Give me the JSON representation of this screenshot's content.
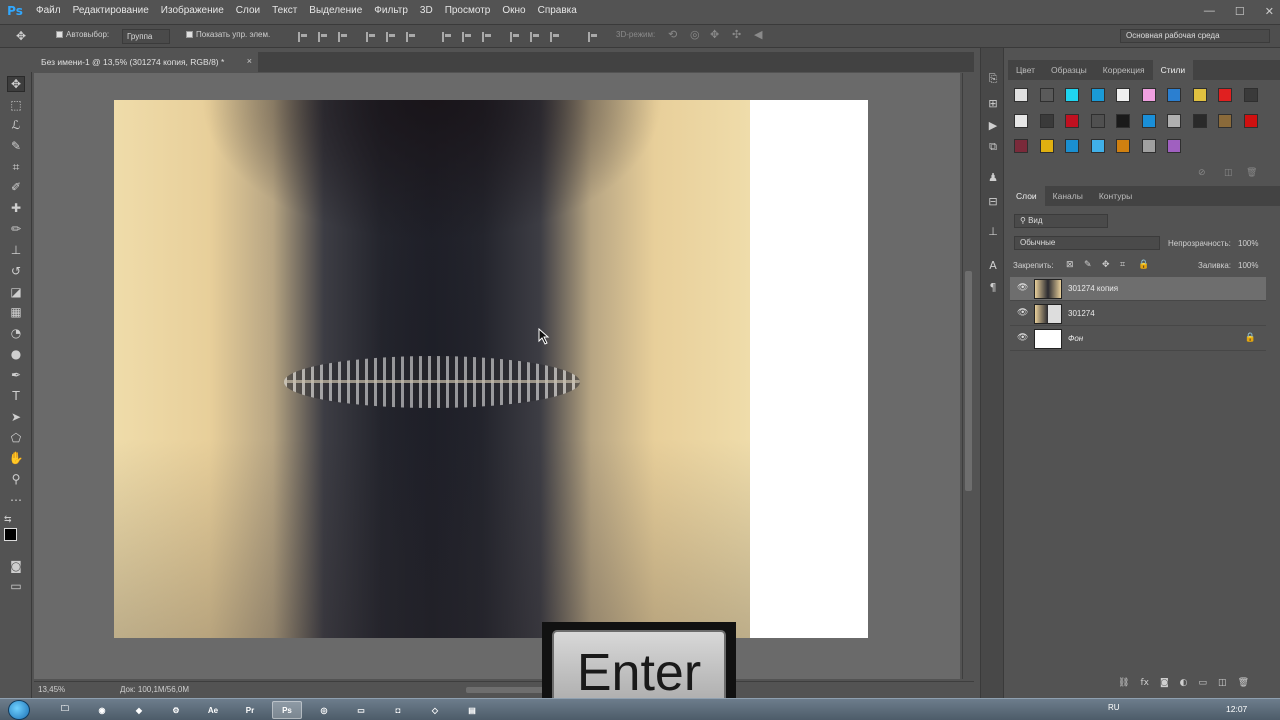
{
  "app": {
    "logo": "Ps"
  },
  "menu": [
    "Файл",
    "Редактирование",
    "Изображение",
    "Слои",
    "Текст",
    "Выделение",
    "Фильтр",
    "3D",
    "Просмотр",
    "Окно",
    "Справка"
  ],
  "window_controls": [
    "—",
    "☐",
    "✕"
  ],
  "options": {
    "autoselect_label": "Автовыбор:",
    "autoselect_value": "Группа",
    "show_transform_label": "Показать упр. элем.",
    "mode_3d_label": "3D-режим:",
    "workspace": "Основная рабочая среда"
  },
  "document": {
    "tab_title": "Без имени-1 @ 13,5% (301274 копия, RGB/8) *",
    "close_glyph": "×",
    "zoom": "13,45%",
    "doc_info": "Док: 100,1M/56,0M"
  },
  "styles_panel": {
    "tabs": [
      "Цвет",
      "Образцы",
      "Коррекция",
      "Стили"
    ],
    "active_tab": "Стили",
    "swatch_colors": [
      "#e0e0e0",
      "#5a5a5a",
      "#1fd5f0",
      "#1a9ad6",
      "#f0f0f0",
      "#f0a0e0",
      "#2b7fd0",
      "#e0c040",
      "#e02020",
      "#3a3a3a",
      "#e6e6e6",
      "#3a3a3a",
      "#c01020",
      "#505050",
      "#1a1a1a",
      "#1a8fd8",
      "#b0b0b0",
      "#2a2a2a",
      "#8a6a3a",
      "#d01010",
      "#7a2a3a",
      "#e0b010",
      "#1a8fd0",
      "#40b0e8",
      "#d08010",
      "#a0a0a0",
      "#a060c0"
    ]
  },
  "layers_panel": {
    "tabs": [
      "Слои",
      "Каналы",
      "Контуры"
    ],
    "active_tab": "Слои",
    "kind_filter": "Вид",
    "blend_mode": "Обычные",
    "opacity_label": "Непрозрачность:",
    "opacity_value": "100%",
    "lock_label": "Закрепить:",
    "fill_label": "Заливка:",
    "fill_value": "100%",
    "layers": [
      {
        "name": "301274 копия",
        "selected": true,
        "visible": true,
        "locked": false
      },
      {
        "name": "301274",
        "selected": false,
        "visible": true,
        "locked": false
      },
      {
        "name": "Фон",
        "selected": false,
        "visible": true,
        "locked": true
      }
    ]
  },
  "overlay": {
    "key_label": "Enter"
  },
  "taskbar": {
    "apps": [
      "🗀",
      "◉",
      "◆",
      "⚙",
      "Ae",
      "Pr",
      "Ps",
      "◎",
      "▭",
      "◘",
      "◇",
      "▤"
    ],
    "lang": "RU",
    "clock": "12:07"
  }
}
